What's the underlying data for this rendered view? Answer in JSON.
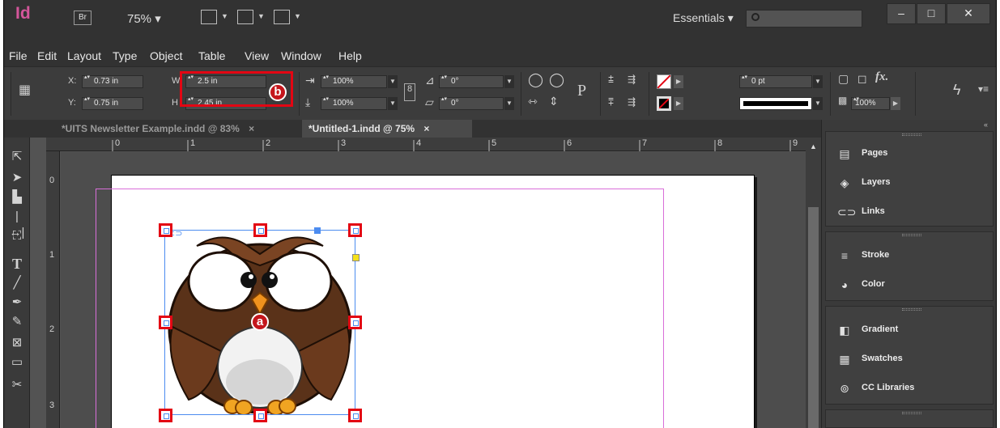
{
  "app": {
    "logo": "Id",
    "bridge": "Br",
    "zoom": "75% ▾",
    "workspace": "Essentials ▾"
  },
  "menu": [
    "File",
    "Edit",
    "Layout",
    "Type",
    "Object",
    "Table",
    "View",
    "Window",
    "Help"
  ],
  "control": {
    "x_label": "X:",
    "x_value": "0.73 in",
    "y_label": "Y:",
    "y_value": "0.75 in",
    "w_label": "W",
    "w_value": "2.5 in",
    "h_label": "H",
    "h_value": "2.45 in",
    "scale_x": "100%",
    "scale_y": "100%",
    "rotate": "0°",
    "shear": "0°",
    "stroke_weight": "0 pt",
    "opacity": "100%",
    "fx": "fx."
  },
  "tabs": [
    {
      "label": "*UITS Newsletter Example.indd @ 83%",
      "close": "×"
    },
    {
      "label": "*Untitled-1.indd @ 75%",
      "close": "×"
    }
  ],
  "rulers": {
    "h": [
      "0",
      "1",
      "2",
      "3",
      "4",
      "5",
      "6",
      "7",
      "8",
      "9"
    ],
    "v": [
      "0",
      "1",
      "2",
      "3"
    ]
  },
  "callouts": {
    "a": "a",
    "b": "b"
  },
  "panels": {
    "group1": [
      "Pages",
      "Layers",
      "Links"
    ],
    "group2": [
      "Stroke",
      "Color"
    ],
    "group3": [
      "Gradient",
      "Swatches",
      "CC Libraries"
    ]
  },
  "icons": [
    "search-icon",
    "minimize-icon",
    "maximize-icon",
    "close-icon",
    "pages-icon",
    "layers-icon",
    "links-icon",
    "stroke-icon",
    "color-icon",
    "gradient-icon",
    "swatches-icon",
    "cc-libraries-icon",
    "lightning-icon",
    "panel-menu-icon"
  ]
}
